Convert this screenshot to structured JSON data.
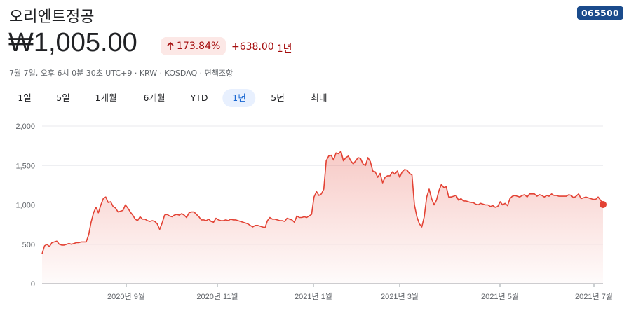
{
  "header": {
    "title": "오리엔트정공",
    "ticker": "065500",
    "price": "₩1,005.00",
    "percent_change": "173.84%",
    "change_value": "+638.00",
    "change_period": "1년",
    "meta": "7월 7일, 오후 6시 0분 30초 UTC+9 · KRW · KOSDAQ · 면책조항",
    "arrow_icon": "arrow-up-icon",
    "colors": {
      "down_red": "#a50e0e",
      "line": "#e34234",
      "ticker_bg": "#1a4b8c"
    }
  },
  "tabs": [
    {
      "label": "1일"
    },
    {
      "label": "5일"
    },
    {
      "label": "1개월"
    },
    {
      "label": "6개월"
    },
    {
      "label": "YTD"
    },
    {
      "label": "1년",
      "active": true
    },
    {
      "label": "5년"
    },
    {
      "label": "최대"
    }
  ],
  "chart_data": {
    "type": "area",
    "ylim": [
      0,
      2000
    ],
    "yticks": [
      0,
      500,
      1000,
      1500,
      2000
    ],
    "ytick_labels": [
      "0",
      "500",
      "1,000",
      "1,500",
      "2,000"
    ],
    "xtick_labels": [
      "2020년 9월",
      "2020년 11월",
      "2021년 1월",
      "2021년 3월",
      "2021년 5월",
      "2021년 7월"
    ],
    "grid": true,
    "series": [
      {
        "values": [
          380,
          480,
          500,
          470,
          520,
          530,
          540,
          500,
          490,
          490,
          500,
          510,
          500,
          510,
          520,
          520,
          530,
          530,
          530,
          620,
          780,
          900,
          970,
          900,
          1000,
          1080,
          1100,
          1030,
          1040,
          980,
          960,
          910,
          920,
          930,
          1000,
          960,
          910,
          870,
          820,
          800,
          850,
          820,
          820,
          800,
          790,
          800,
          790,
          760,
          690,
          770,
          870,
          880,
          860,
          850,
          870,
          880,
          870,
          890,
          870,
          840,
          900,
          910,
          910,
          880,
          850,
          810,
          810,
          800,
          820,
          790,
          780,
          830,
          810,
          800,
          800,
          810,
          800,
          820,
          810,
          810,
          800,
          790,
          780,
          770,
          760,
          740,
          720,
          740,
          740,
          730,
          720,
          710,
          800,
          840,
          820,
          820,
          810,
          800,
          800,
          790,
          830,
          820,
          810,
          780,
          860,
          840,
          840,
          850,
          840,
          860,
          880,
          1100,
          1170,
          1120,
          1140,
          1200,
          1560,
          1620,
          1630,
          1570,
          1660,
          1650,
          1680,
          1560,
          1600,
          1620,
          1560,
          1520,
          1560,
          1600,
          1590,
          1520,
          1500,
          1600,
          1550,
          1430,
          1420,
          1350,
          1400,
          1280,
          1350,
          1370,
          1370,
          1420,
          1390,
          1430,
          1350,
          1420,
          1450,
          1440,
          1400,
          1380,
          1000,
          850,
          760,
          720,
          850,
          1100,
          1200,
          1080,
          1000,
          1060,
          1180,
          1260,
          1220,
          1230,
          1100,
          1100,
          1110,
          1120,
          1060,
          1080,
          1050,
          1050,
          1040,
          1030,
          1030,
          1010,
          1000,
          1020,
          1010,
          1000,
          1000,
          980,
          990,
          970,
          980,
          1040,
          1000,
          1020,
          990,
          1080,
          1110,
          1120,
          1110,
          1100,
          1120,
          1130,
          1100,
          1140,
          1140,
          1140,
          1110,
          1130,
          1120,
          1100,
          1120,
          1110,
          1140,
          1120,
          1120,
          1110,
          1110,
          1110,
          1110,
          1130,
          1120,
          1090,
          1110,
          1140,
          1080,
          1090,
          1100,
          1090,
          1080,
          1070,
          1070,
          1100,
          1060,
          1005
        ]
      }
    ]
  }
}
